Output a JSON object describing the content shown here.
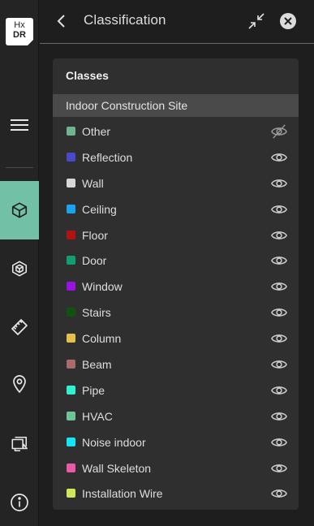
{
  "logo": {
    "line1": "Hx",
    "line2": "DR"
  },
  "header": {
    "title": "Classification"
  },
  "panel": {
    "heading": "Classes",
    "group": "Indoor Construction Site"
  },
  "rail_items": [
    {
      "icon": "hamburger-menu-icon"
    },
    {
      "icon": "cube-icon",
      "active": true
    },
    {
      "icon": "hexagon-box-icon"
    },
    {
      "icon": "ruler-icon"
    },
    {
      "icon": "location-pin-icon"
    },
    {
      "icon": "monitor-layers-icon"
    },
    {
      "icon": "info-icon"
    }
  ],
  "classes": [
    {
      "label": "Other",
      "color": "#6fb38f",
      "visible": false
    },
    {
      "label": "Reflection",
      "color": "#4a4ac9",
      "visible": true
    },
    {
      "label": "Wall",
      "color": "#d8d8d8",
      "visible": true
    },
    {
      "label": "Ceiling",
      "color": "#1aa3f0",
      "visible": true
    },
    {
      "label": "Floor",
      "color": "#b31212",
      "visible": true
    },
    {
      "label": "Door",
      "color": "#129e73",
      "visible": true
    },
    {
      "label": "Window",
      "color": "#9a12e0",
      "visible": true
    },
    {
      "label": "Stairs",
      "color": "#12520f",
      "visible": true
    },
    {
      "label": "Column",
      "color": "#e6c04a",
      "visible": true
    },
    {
      "label": "Beam",
      "color": "#a86a6a",
      "visible": true
    },
    {
      "label": "Pipe",
      "color": "#2ef2d0",
      "visible": true
    },
    {
      "label": "HVAC",
      "color": "#6fc49a",
      "visible": true
    },
    {
      "label": "Noise indoor",
      "color": "#12e8f5",
      "visible": true
    },
    {
      "label": "Wall Skeleton",
      "color": "#e85aa8",
      "visible": true
    },
    {
      "label": "Installation Wire",
      "color": "#cfe85a",
      "visible": true
    }
  ]
}
